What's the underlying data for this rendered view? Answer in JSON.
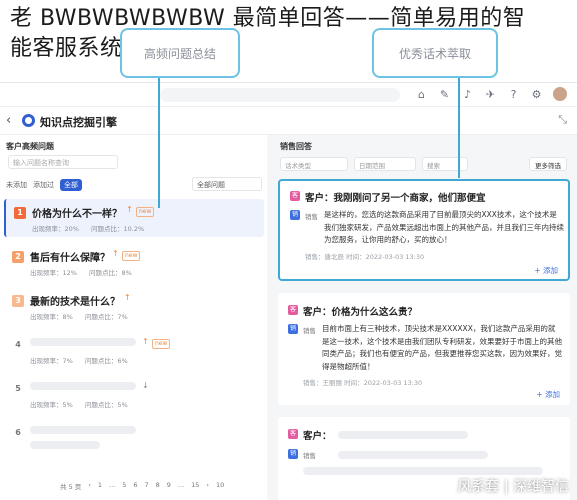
{
  "headline": {
    "line1": "老 BWBWBWBWBW 最简单回答——简单易用的智",
    "line2": "能客服系统"
  },
  "callouts": {
    "left": "高频问题总结",
    "right": "优秀话术萃取"
  },
  "topbar": {
    "icons": [
      "home-icon",
      "edit-icon",
      "bell-icon",
      "plane-icon",
      "help-icon",
      "settings-icon"
    ]
  },
  "header": {
    "back": "‹",
    "title": "知识点挖掘引擎",
    "right_icon": "⤡"
  },
  "left_panel": {
    "title": "客户高频问题",
    "search_placeholder": "输入问题名称查询",
    "filters": [
      "未添加",
      "添加过",
      "全部"
    ],
    "dropdown": "全部问题",
    "items": [
      {
        "num": "1",
        "text": "价格为什么不一样？",
        "trend": "↑",
        "new": "new",
        "freq": "出现频率：20%",
        "click": "问题点比：10.2%"
      },
      {
        "num": "2",
        "text": "售后有什么保障？",
        "trend": "↑",
        "new": "new",
        "freq": "出现频率：12%",
        "click": "问题点比：8%"
      },
      {
        "num": "3",
        "text": "最新的技术是什么？",
        "trend": "↑",
        "new": "",
        "freq": "出现频率：8%",
        "click": "问题点比：7%"
      },
      {
        "num": "4",
        "text": "",
        "trend": "↑",
        "new": "new",
        "freq": "出现频率：7%",
        "click": "问题点比：6%"
      },
      {
        "num": "5",
        "text": "",
        "trend": "↓",
        "new": "",
        "freq": "出现频率：5%",
        "click": "问题点比：5%"
      },
      {
        "num": "6",
        "text": "",
        "trend": "",
        "new": "",
        "freq": "",
        "click": ""
      }
    ],
    "pager": [
      "共 5 页",
      "‹",
      "1",
      "...",
      "5",
      "6",
      "7",
      "8",
      "9",
      "...",
      "15",
      "›",
      "10"
    ]
  },
  "right_panel": {
    "title": "销售回答",
    "filters": [
      "话术类型",
      "日期范围",
      "搜索"
    ],
    "more_filter": "更多筛选",
    "cards": [
      {
        "customer_badge": "客",
        "customer": "客户：我刚刚问了另一个商家，他们那便宜",
        "sales_badge": "销",
        "sales_label": "销售",
        "sales": "是这样的，您选的这款商品采用了目前最顶尖的XXX技术，这个技术是我们独家研发，产品效果远超出市面上的其他产品，并且我们三年内持续为您服务，让你用的舒心，买的放心！",
        "meta": "销售：唐北辰     时间：2022-03-03 13:30",
        "add": "+ 添加"
      },
      {
        "customer_badge": "客",
        "customer": "客户：价格为什么这么贵？",
        "sales_badge": "销",
        "sales_label": "销售",
        "sales": "目前市面上有三种技术，顶尖技术是XXXXXX，我们这款产品采用的就是这一技术，这个技术是由我们团队专利研发，效果要好于市面上的其他同类产品；我们也有便宜的产品，但我更推荐您买这款，因为效果好，觉得是物超所值！",
        "meta": "销售：王丽丽     时间：2022-03-03 13:30",
        "add": "+ 添加"
      },
      {
        "customer_badge": "客",
        "customer": "客户：",
        "sales_badge": "销",
        "sales_label": "销售",
        "sales": "",
        "meta": "",
        "add": ""
      }
    ]
  },
  "watermark": "风系套 | 深维智信",
  "colors": {
    "accent": "#2f5fd0",
    "callout_border": "#6cc3e3",
    "highlight": "#3fa9d4",
    "customer_badge": "#e35ca0",
    "sales_badge": "#3d6fe0",
    "rank1": "#f06a3a",
    "rank2": "#f5a06b",
    "rank3": "#f7b98f"
  }
}
